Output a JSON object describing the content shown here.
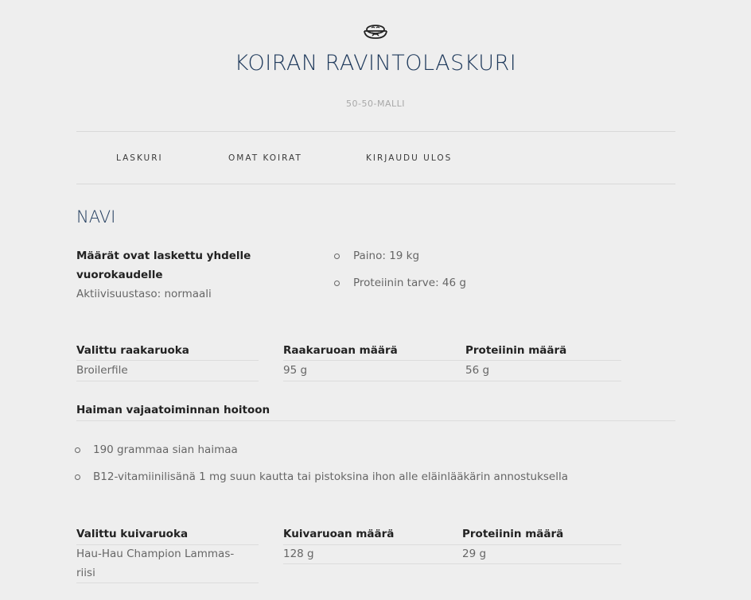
{
  "header": {
    "logo_icon": "dog-bowl-icon",
    "title": "KOIRAN RAVINTOLASKURI",
    "subtitle": "50-50-MALLI"
  },
  "nav": {
    "items": [
      {
        "label": "LASKURI"
      },
      {
        "label": "OMAT KOIRAT"
      },
      {
        "label": "KIRJAUDU ULOS"
      }
    ]
  },
  "dog": {
    "name": "NAVI",
    "note_line1": "Määrät ovat laskettu yhdelle",
    "note_line2": "vuorokaudelle",
    "activity": "Aktiivisuustaso: normaali",
    "facts": [
      "Paino: 19 kg",
      "Proteiinin tarve: 46 g"
    ]
  },
  "raw_table": {
    "headers": [
      "Valittu raakaruoka",
      "Raakaruoan määrä",
      "Proteiinin määrä"
    ],
    "rows": [
      [
        "Broilerfile",
        "95 g",
        "56 g"
      ]
    ]
  },
  "pancreas": {
    "title": "Haiman vajaatoiminnan hoitoon",
    "items": [
      "190 grammaa sian haimaa",
      "B12-vitamiinilisänä 1 mg suun kautta tai pistoksina ihon alle eläinlääkärin annostuksella"
    ]
  },
  "dry_table": {
    "headers": [
      "Valittu kuivaruoka",
      "Kuivaruoan määrä",
      "Proteiinin määrä"
    ],
    "rows": [
      [
        "Hau-Hau Champion Lammas-",
        "riisi",
        "128 g",
        "29 g"
      ]
    ]
  },
  "colors": {
    "background": "#eeeeee",
    "title": "#1f3a5c",
    "text": "#666666"
  }
}
